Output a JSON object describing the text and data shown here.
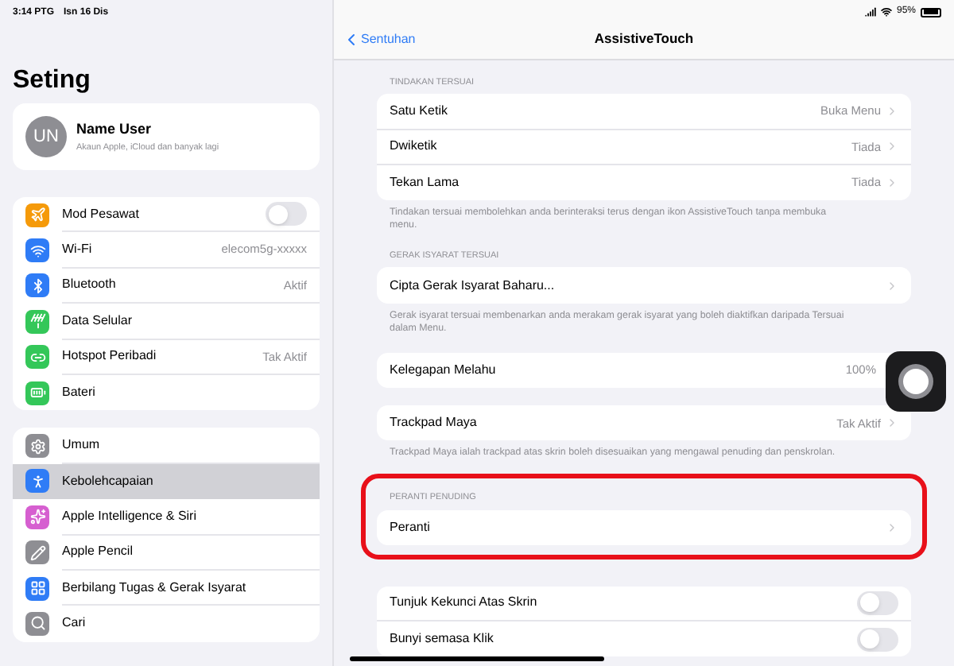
{
  "status_bar": {
    "time": "3:14 PTG",
    "date": "Isn 16 Dis",
    "battery": "95%"
  },
  "sidebar": {
    "title": "Seting",
    "profile": {
      "initials": "UN",
      "name": "Name User",
      "subtitle": "Akaun Apple, iCloud dan banyak lagi"
    },
    "groups": [
      [
        {
          "label": "Mod Pesawat",
          "color": "#f59a0a",
          "kind": "toggle",
          "on": false,
          "selected": false
        },
        {
          "label": "Wi-Fi",
          "color": "#2f7cf6",
          "kind": "value",
          "value": "elecom5g-xxxxx",
          "selected": false
        },
        {
          "label": "Bluetooth",
          "color": "#2f7cf6",
          "kind": "value",
          "value": "Aktif",
          "selected": false
        },
        {
          "label": "Data Selular",
          "color": "#34c759",
          "kind": "plain",
          "selected": false
        },
        {
          "label": "Hotspot Peribadi",
          "color": "#34c759",
          "kind": "value",
          "value": "Tak Aktif",
          "selected": false
        },
        {
          "label": "Bateri",
          "color": "#34c759",
          "kind": "plain",
          "selected": false
        }
      ],
      [
        {
          "label": "Umum",
          "color": "#8e8e93",
          "kind": "plain",
          "selected": false
        },
        {
          "label": "Kebolehcapaian",
          "color": "#2f7cf6",
          "kind": "plain",
          "selected": true
        },
        {
          "label": "Apple Intelligence & Siri",
          "color": "#d65fd0",
          "kind": "plain",
          "selected": false
        },
        {
          "label": "Apple Pencil",
          "color": "#8e8e93",
          "kind": "plain",
          "selected": false
        },
        {
          "label": "Berbilang Tugas & Gerak Isyarat",
          "color": "#2f7cf6",
          "kind": "plain",
          "selected": false
        },
        {
          "label": "Cari",
          "color": "#8e8e93",
          "kind": "plain",
          "selected": false
        }
      ]
    ]
  },
  "nav": {
    "back": "Sentuhan",
    "title": "AssistiveTouch"
  },
  "sections": [
    {
      "header": "TINDAKAN TERSUAI",
      "highlighted": false,
      "rows": [
        {
          "kind": "link",
          "label": "Satu Ketik",
          "value": "Buka Menu"
        },
        {
          "kind": "link",
          "label": "Dwiketik",
          "value": "Tiada"
        },
        {
          "kind": "link",
          "label": "Tekan Lama",
          "value": "Tiada"
        }
      ],
      "footer": "Tindakan tersuai membolehkan anda berinteraksi terus dengan ikon AssistiveTouch tanpa membuka menu."
    },
    {
      "header": "GERAK ISYARAT TERSUAI",
      "highlighted": false,
      "rows": [
        {
          "kind": "link",
          "label": "Cipta Gerak Isyarat Baharu..."
        }
      ],
      "footer": "Gerak isyarat tersuai membenarkan anda merakam gerak isyarat yang boleh diaktifkan daripada Tersuai dalam Menu."
    },
    {
      "highlighted": false,
      "rows": [
        {
          "kind": "value",
          "label": "Kelegapan Melahu",
          "value": "100%"
        }
      ]
    },
    {
      "highlighted": false,
      "rows": [
        {
          "kind": "link",
          "label": "Trackpad Maya",
          "value": "Tak Aktif"
        }
      ],
      "footer": "Trackpad Maya ialah trackpad atas skrin boleh disesuaikan yang mengawal penuding dan penskrolan."
    },
    {
      "header": "PERANTI PENUDING",
      "highlighted": true,
      "rows": [
        {
          "kind": "link",
          "label": "Peranti"
        }
      ]
    },
    {
      "highlighted": false,
      "rows": [
        {
          "kind": "toggle",
          "label": "Tunjuk Kekunci Atas Skrin",
          "on": false
        },
        {
          "kind": "toggle",
          "label": "Bunyi semasa Klik",
          "on": false
        }
      ]
    }
  ]
}
